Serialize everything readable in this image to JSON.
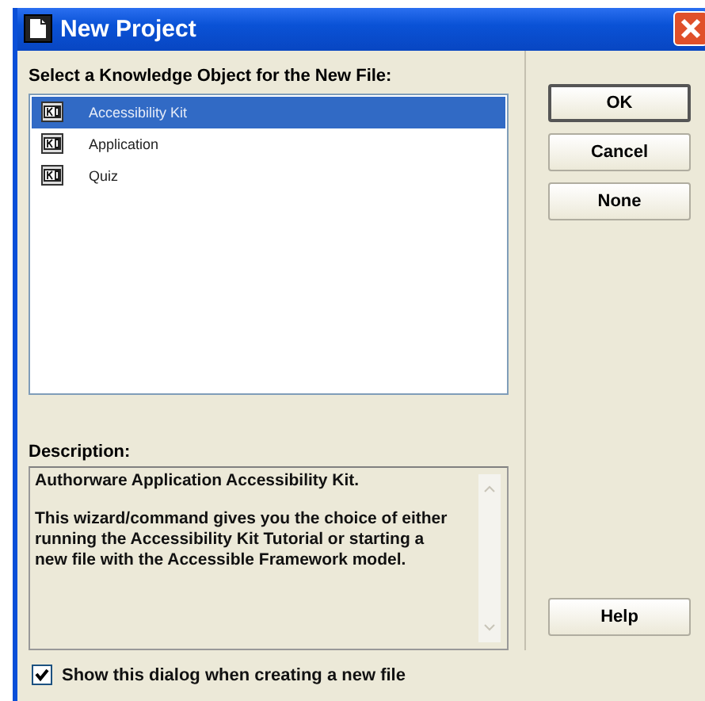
{
  "window": {
    "title": "New Project"
  },
  "list_label": "Select a Knowledge Object for the New File:",
  "items": [
    {
      "label": "Accessibility Kit",
      "selected": true
    },
    {
      "label": "Application",
      "selected": false
    },
    {
      "label": "Quiz",
      "selected": false
    }
  ],
  "buttons": [
    "OK",
    "Cancel",
    "None"
  ],
  "description": {
    "label": "Description:",
    "paragraphs": [
      "Authorware Application Accessibility Kit.",
      "This wizard/command gives you the choice of either running the Accessibility Kit Tutorial or starting a new file with the Accessible Framework model."
    ]
  },
  "help_button": "Help",
  "show_dialog": {
    "label": "Show this dialog when creating a new file",
    "checked": true
  }
}
